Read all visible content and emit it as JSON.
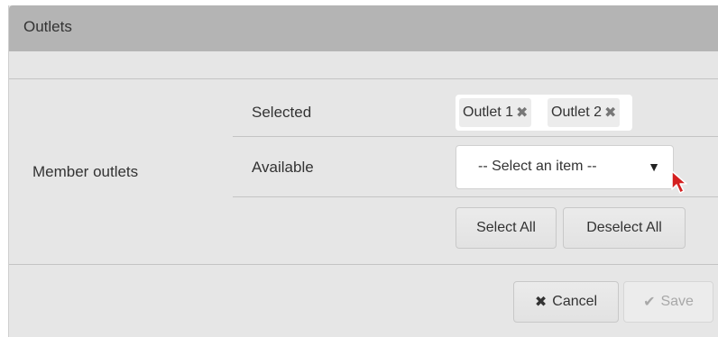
{
  "panel": {
    "title": "Outlets"
  },
  "form": {
    "row_label": "Member outlets",
    "selected_label": "Selected",
    "available_label": "Available",
    "selected_items": [
      {
        "label": "Outlet 1",
        "remove_icon": "✖"
      },
      {
        "label": "Outlet 2",
        "remove_icon": "✖"
      }
    ],
    "select": {
      "value": "-- Select an item --",
      "caret": "▼"
    },
    "select_all_label": "Select All",
    "deselect_all_label": "Deselect All"
  },
  "footer": {
    "cancel_label": "Cancel",
    "cancel_icon": "✖",
    "save_label": "Save",
    "save_icon": "✔"
  },
  "colors": {
    "header": "#b4b4b4",
    "panel_bg": "#e6e6e6",
    "cursor": "#d42020"
  }
}
